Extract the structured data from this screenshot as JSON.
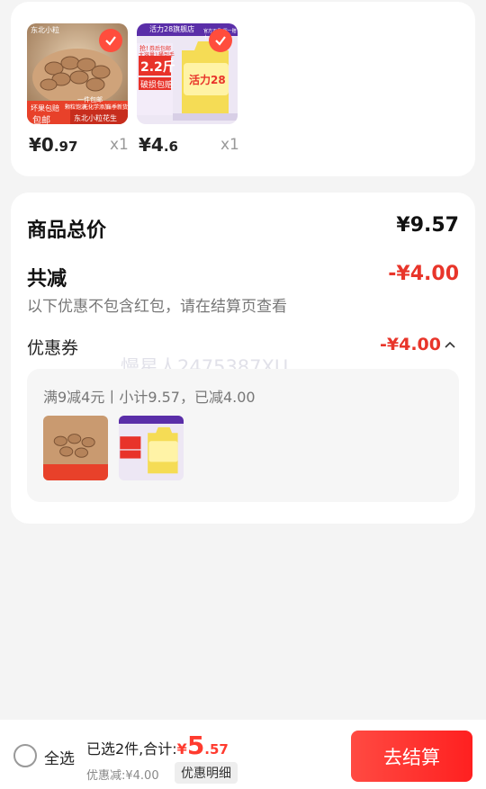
{
  "items": [
    {
      "price_symbol": "¥",
      "price_int": "0",
      "price_dec": ".97",
      "qty": "x1",
      "image_text": {
        "tag1": "东北小粒",
        "tag2": "一件包邮",
        "promo": "坏果包赔",
        "badge": "包邮",
        "caption": "东北小粒花生",
        "mid1": "颗粒饱满",
        "mid2": "无化学添加",
        "mid3": "当季新货"
      }
    },
    {
      "price_symbol": "¥",
      "price_int": "4",
      "price_dec": ".6",
      "qty": "x1",
      "image_text": {
        "brand": "活力28旗舰店",
        "top_right": "官方正品 假一赔十",
        "promo1": "大容量1桶到手",
        "big_num": "2.2斤",
        "promo2": "破损包赔",
        "logo": "活力28",
        "hot": "抢!",
        "hot2": "券后包邮"
      }
    }
  ],
  "summary": {
    "total_label": "商品总价",
    "total_value": "¥9.57",
    "discount_label": "共减",
    "discount_value": "-¥4.00",
    "discount_note": "以下优惠不包含红包，请在结算页查看",
    "coupon_label": "优惠券",
    "coupon_value": "-¥4.00",
    "coupon_detail": "满9减4元丨小计9.57，已减4.00"
  },
  "watermark": "慢星人2475387XU",
  "bottom": {
    "select_all": "全选",
    "selected_text": "已选2件,合计:",
    "total_symbol": "¥",
    "total_int": "5",
    "total_dec": ".57",
    "discount_text": "优惠减:¥4.00",
    "detail_btn": "优惠明细",
    "checkout": "去结算"
  },
  "colors": {
    "accent": "#ff3b2f",
    "discount": "#e8352a"
  }
}
